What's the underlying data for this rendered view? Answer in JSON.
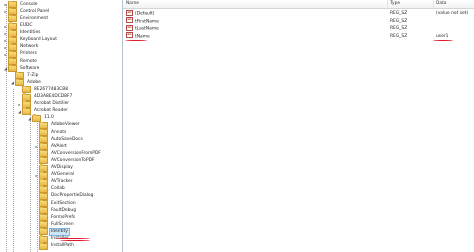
{
  "tree": {
    "items": [
      {
        "label": "Console",
        "expander": "▸",
        "level": 1
      },
      {
        "label": "Control Panel",
        "expander": "▸",
        "level": 1
      },
      {
        "label": "Environment",
        "expander": "",
        "level": 1
      },
      {
        "label": "EUDC",
        "expander": "▸",
        "level": 1
      },
      {
        "label": "Identities",
        "expander": "▸",
        "level": 1
      },
      {
        "label": "Keyboard Layout",
        "expander": "▸",
        "level": 1
      },
      {
        "label": "Network",
        "expander": "▸",
        "level": 1
      },
      {
        "label": "Printers",
        "expander": "▸",
        "level": 1
      },
      {
        "label": "Remote",
        "expander": "",
        "level": 1
      },
      {
        "label": "Software",
        "expander": "◢",
        "level": 1
      },
      {
        "label": "7-Zip",
        "expander": "",
        "level": 2
      },
      {
        "label": "Adobe",
        "expander": "◢",
        "level": 2
      },
      {
        "label": "8E2677483CB8",
        "expander": "",
        "level": 3
      },
      {
        "label": "4D3A8E4DCD8F7",
        "expander": "",
        "level": 3
      },
      {
        "label": "Acrobat Distiller",
        "expander": "▸",
        "level": 3
      },
      {
        "label": "Acrobat Reader",
        "expander": "◢",
        "level": 3
      },
      {
        "label": "11.0",
        "expander": "◢",
        "level": 4
      },
      {
        "label": "AdobeViewer",
        "expander": "",
        "level": 5
      },
      {
        "label": "Annots",
        "expander": "",
        "level": 5
      },
      {
        "label": "AutoSaveDocs",
        "expander": "",
        "level": 5
      },
      {
        "label": "AVAlert",
        "expander": "▸",
        "level": 5
      },
      {
        "label": "AVConversionFromPDF",
        "expander": "",
        "level": 5
      },
      {
        "label": "AVConversionToPDF",
        "expander": "",
        "level": 5
      },
      {
        "label": "AVDisplay",
        "expander": "",
        "level": 5
      },
      {
        "label": "AVGeneral",
        "expander": "▸",
        "level": 5
      },
      {
        "label": "AVTracker",
        "expander": "",
        "level": 5
      },
      {
        "label": "Collab",
        "expander": "",
        "level": 5
      },
      {
        "label": "DocPropertieDialog",
        "expander": "",
        "level": 5
      },
      {
        "label": "ExitSection",
        "expander": "",
        "level": 5
      },
      {
        "label": "FaultDebug",
        "expander": "",
        "level": 5
      },
      {
        "label": "FormsPrefs",
        "expander": "",
        "level": 5
      },
      {
        "label": "FullScreen",
        "expander": "",
        "level": 5
      },
      {
        "label": "Identity",
        "expander": "",
        "level": 5,
        "selected": true
      },
      {
        "label": "Installer",
        "expander": "",
        "level": 5
      },
      {
        "label": "InstallPath",
        "expander": "",
        "level": 5
      }
    ]
  },
  "values": {
    "columns": {
      "name": "Name",
      "type": "Type",
      "data": "Data"
    },
    "rows": [
      {
        "name": "(Default)",
        "type": "REG_SZ",
        "data": "(value not set)"
      },
      {
        "name": "tFirstName",
        "type": "REG_SZ",
        "data": ""
      },
      {
        "name": "tLastName",
        "type": "REG_SZ",
        "data": ""
      },
      {
        "name": "tName",
        "type": "REG_SZ",
        "data": "user1"
      }
    ]
  },
  "colors": {
    "selection": "#cde6f7",
    "annotation_red": "#e0192b",
    "folder": "#e8b94b"
  }
}
